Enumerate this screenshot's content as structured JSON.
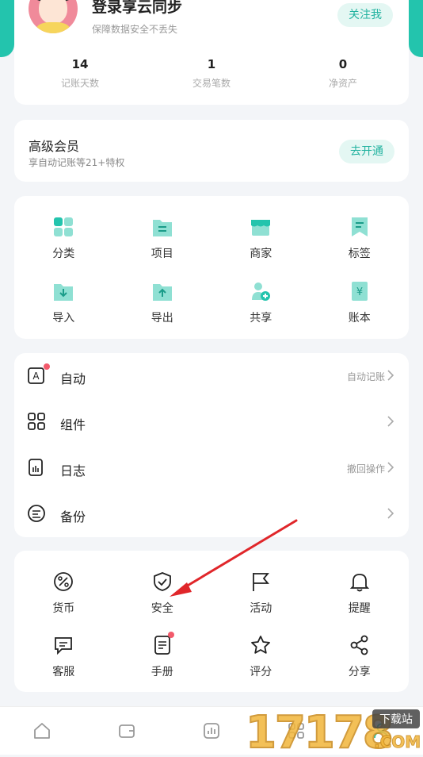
{
  "profile": {
    "title": "登录享云同步",
    "subtitle": "保障数据安全不丢失",
    "follow": "关注我",
    "stats": [
      {
        "num": "14",
        "label": "记账天数"
      },
      {
        "num": "1",
        "label": "交易笔数"
      },
      {
        "num": "0",
        "label": "净资产"
      }
    ]
  },
  "vip": {
    "title": "高级会员",
    "subtitle": "享自动记账等21+特权",
    "button": "去开通"
  },
  "grid1": [
    {
      "label": "分类",
      "icon": "category-icon"
    },
    {
      "label": "项目",
      "icon": "project-icon"
    },
    {
      "label": "商家",
      "icon": "merchant-icon"
    },
    {
      "label": "标签",
      "icon": "tag-icon"
    },
    {
      "label": "导入",
      "icon": "import-icon"
    },
    {
      "label": "导出",
      "icon": "export-icon"
    },
    {
      "label": "共享",
      "icon": "share-users-icon"
    },
    {
      "label": "账本",
      "icon": "ledger-icon"
    }
  ],
  "list": [
    {
      "label": "自动",
      "hint": "自动记账",
      "icon": "auto-icon"
    },
    {
      "label": "组件",
      "hint": "",
      "icon": "widget-icon"
    },
    {
      "label": "日志",
      "hint": "撤回操作",
      "icon": "log-icon"
    },
    {
      "label": "备份",
      "hint": "",
      "icon": "backup-icon"
    }
  ],
  "grid2": [
    {
      "label": "货币",
      "icon": "currency-icon"
    },
    {
      "label": "安全",
      "icon": "shield-icon"
    },
    {
      "label": "活动",
      "icon": "flag-icon"
    },
    {
      "label": "提醒",
      "icon": "bell-icon"
    },
    {
      "label": "客服",
      "icon": "chat-icon"
    },
    {
      "label": "手册",
      "icon": "manual-icon"
    },
    {
      "label": "评分",
      "icon": "star-icon"
    },
    {
      "label": "分享",
      "icon": "share-icon"
    }
  ],
  "watermark": {
    "text": "17178",
    "badge": "下载站",
    "domain": ".COM"
  },
  "colors": {
    "accent": "#23c4ad",
    "accent_light": "#e4f7f3",
    "red_dot": "#f25a6b",
    "arrow": "#e0262a"
  }
}
